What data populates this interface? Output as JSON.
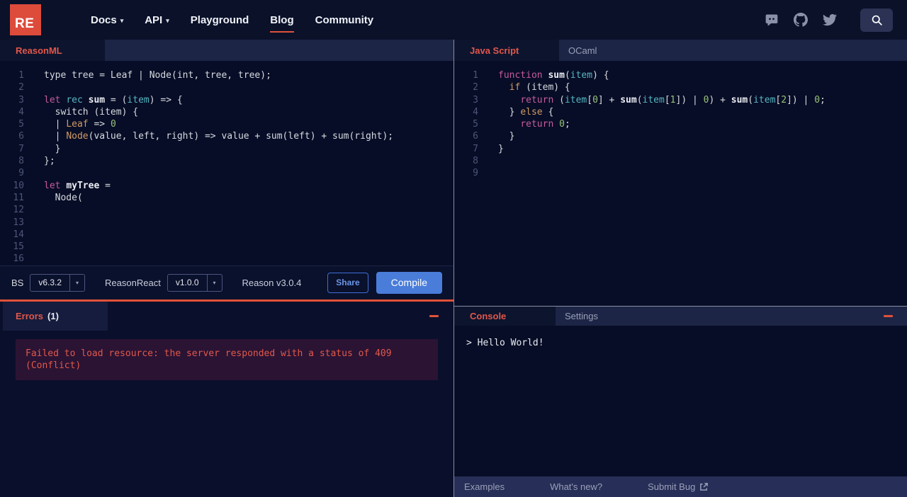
{
  "nav": {
    "logo_text": "RE",
    "items": [
      {
        "label": "Docs",
        "caret": true,
        "active": false
      },
      {
        "label": "API",
        "caret": true,
        "active": false
      },
      {
        "label": "Playground",
        "caret": false,
        "active": false
      },
      {
        "label": "Blog",
        "caret": false,
        "active": true
      },
      {
        "label": "Community",
        "caret": false,
        "active": false
      }
    ],
    "social_icons": [
      "discord-icon",
      "github-icon",
      "twitter-icon"
    ],
    "search_icon": "search-icon"
  },
  "left_pane": {
    "tab_label": "ReasonML",
    "editor_lines": [
      [
        [
          "type tree = Leaf | Node(int, tree, tree);",
          "pl"
        ]
      ],
      [],
      [
        [
          "let",
          "kw"
        ],
        [
          " ",
          "pl"
        ],
        [
          "rec",
          "cy"
        ],
        [
          " ",
          "pl"
        ],
        [
          "sum",
          "fn"
        ],
        [
          " = (",
          "pl"
        ],
        [
          "item",
          "cy"
        ],
        [
          ") => {",
          "pl"
        ]
      ],
      [
        [
          "  switch (item) {",
          "pl"
        ]
      ],
      [
        [
          "  | ",
          "pl"
        ],
        [
          "Leaf",
          "or"
        ],
        [
          " => ",
          "pl"
        ],
        [
          "0",
          "gr"
        ]
      ],
      [
        [
          "  | ",
          "pl"
        ],
        [
          "Node",
          "or"
        ],
        [
          "(value, left, right) => value + sum(left) + sum(right);",
          "pl"
        ]
      ],
      [
        [
          "  }",
          "pl"
        ]
      ],
      [
        [
          "};",
          "pl"
        ]
      ],
      [],
      [
        [
          "let",
          "kw"
        ],
        [
          " ",
          "pl"
        ],
        [
          "myTree",
          "fn"
        ],
        [
          " =",
          "pl"
        ]
      ],
      [
        [
          "  Node(",
          "pl"
        ]
      ],
      [],
      [],
      [],
      [],
      [],
      [],
      []
    ],
    "toolbar": {
      "bs_label": "BS",
      "bs_version": "v6.3.2",
      "reasonreact_label": "ReasonReact",
      "reasonreact_version": "v1.0.0",
      "reason_version": "Reason v3.0.4",
      "share_label": "Share",
      "compile_label": "Compile"
    },
    "errors": {
      "title": "Errors",
      "count": "(1)",
      "message": "Failed to load resource: the server responded with a status of 409 (Conflict)"
    }
  },
  "right_pane": {
    "tabs": [
      {
        "label": "Java Script",
        "active": true
      },
      {
        "label": "OCaml",
        "active": false
      }
    ],
    "editor_lines": [
      [
        [
          "function",
          "kw"
        ],
        [
          " ",
          "pl"
        ],
        [
          "sum",
          "fn"
        ],
        [
          "(",
          "pl"
        ],
        [
          "item",
          "cy"
        ],
        [
          ") {",
          "pl"
        ]
      ],
      [
        [
          "  ",
          "pl"
        ],
        [
          "if",
          "or"
        ],
        [
          " (item) {",
          "pl"
        ]
      ],
      [
        [
          "    ",
          "pl"
        ],
        [
          "return",
          "kw"
        ],
        [
          " (",
          "pl"
        ],
        [
          "item",
          "cy"
        ],
        [
          "[",
          "pl"
        ],
        [
          "0",
          "gr"
        ],
        [
          "] + ",
          "pl"
        ],
        [
          "sum",
          "fn"
        ],
        [
          "(",
          "pl"
        ],
        [
          "item",
          "cy"
        ],
        [
          "[",
          "pl"
        ],
        [
          "1",
          "gr"
        ],
        [
          "]) | ",
          "pl"
        ],
        [
          "0",
          "gr"
        ],
        [
          ") + ",
          "pl"
        ],
        [
          "sum",
          "fn"
        ],
        [
          "(",
          "pl"
        ],
        [
          "item",
          "cy"
        ],
        [
          "[",
          "pl"
        ],
        [
          "2",
          "gr"
        ],
        [
          "]) | ",
          "pl"
        ],
        [
          "0",
          "gr"
        ],
        [
          ";",
          "pl"
        ]
      ],
      [
        [
          "  } ",
          "pl"
        ],
        [
          "else",
          "or"
        ],
        [
          " {",
          "pl"
        ]
      ],
      [
        [
          "    ",
          "pl"
        ],
        [
          "return",
          "kw"
        ],
        [
          " ",
          "pl"
        ],
        [
          "0",
          "gr"
        ],
        [
          ";",
          "pl"
        ]
      ],
      [
        [
          "  }",
          "pl"
        ]
      ],
      [
        [
          "}",
          "pl"
        ]
      ],
      [],
      []
    ],
    "console": {
      "tabs": [
        {
          "label": "Console",
          "active": true
        },
        {
          "label": "Settings",
          "active": false
        }
      ],
      "output": "> Hello World!"
    },
    "footer_items": [
      {
        "label": "Examples",
        "external": false
      },
      {
        "label": "What's new?",
        "external": false
      },
      {
        "label": "Submit Bug",
        "external": true
      }
    ]
  },
  "colors": {
    "accent_red": "#e0513a",
    "tab_active_text": "#e2574a",
    "compile_blue": "#4a7dda",
    "share_blue": "#3f6fd6",
    "logo_red": "#dd4b3b",
    "editor_bg": "#070d26",
    "strip_bg": "#1d2546",
    "error_box_bg": "#2b1334"
  }
}
